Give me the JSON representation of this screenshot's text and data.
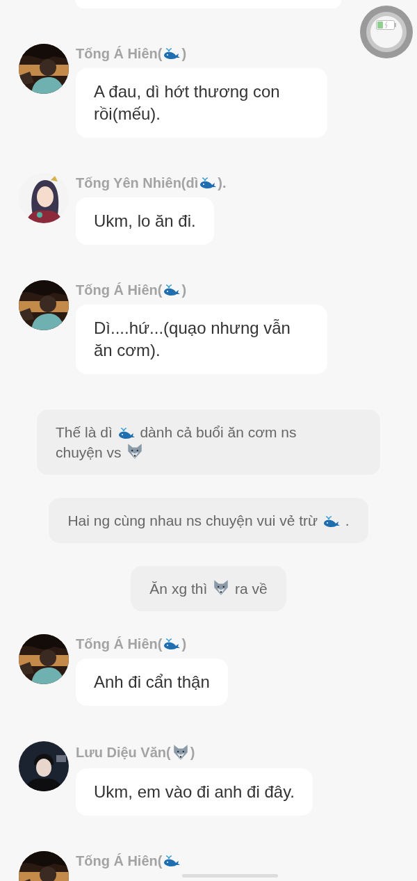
{
  "items": [
    {
      "kind": "cut_bubble"
    },
    {
      "kind": "message",
      "avatar": {
        "kind": "picture"
      },
      "name": [
        {
          "kind": "text",
          "text": "Tống Á Hiên("
        },
        {
          "kind": "whale"
        },
        {
          "kind": "text",
          "text": ")"
        }
      ],
      "text": [
        {
          "kind": "text",
          "text": "A đau, dì hớt thương con rồi(mếu)."
        }
      ]
    },
    {
      "kind": "message",
      "avatar": {
        "kind": "picture"
      },
      "name": [
        {
          "kind": "text",
          "text": "Tống Yên Nhiên(dì"
        },
        {
          "kind": "whale"
        },
        {
          "kind": "text",
          "text": ")."
        }
      ],
      "text": [
        {
          "kind": "text",
          "text": "Ukm, lo ăn đi."
        }
      ]
    },
    {
      "kind": "message",
      "avatar": {
        "kind": "picture"
      },
      "name": [
        {
          "kind": "text",
          "text": "Tống Á Hiên("
        },
        {
          "kind": "whale"
        },
        {
          "kind": "text",
          "text": ")"
        }
      ],
      "text": [
        {
          "kind": "text",
          "text": "Dì....hứ...(quạo nhưng vẫn ăn cơm)."
        }
      ]
    },
    {
      "kind": "narration",
      "text": [
        {
          "kind": "text",
          "text": "Thế là dì"
        },
        {
          "kind": "whale"
        },
        {
          "kind": "text",
          "text": "dành cả buổi ăn cơm ns"
        },
        {
          "kind": "text",
          "text": "chuyện vs"
        },
        {
          "kind": "wolf"
        }
      ]
    },
    {
      "kind": "narration",
      "text": [
        {
          "kind": "text",
          "text": "Hai ng cùng nhau ns chuyện vui vẻ trừ"
        },
        {
          "kind": "whale"
        },
        {
          "kind": "text",
          "text": "."
        }
      ]
    },
    {
      "kind": "narration",
      "text": [
        {
          "kind": "text",
          "text": "Ăn xg thì"
        },
        {
          "kind": "wolf"
        },
        {
          "kind": "text",
          "text": "ra về"
        }
      ]
    },
    {
      "kind": "message",
      "avatar": {
        "kind": "picture"
      },
      "name": [
        {
          "kind": "text",
          "text": "Tống Á Hiên("
        },
        {
          "kind": "whale"
        },
        {
          "kind": "text",
          "text": ")"
        }
      ],
      "text": [
        {
          "kind": "text",
          "text": "Anh đi cẩn thận"
        }
      ]
    },
    {
      "kind": "message",
      "avatar": {
        "kind": "picture"
      },
      "name": [
        {
          "kind": "text",
          "text": "Lưu Diệu Văn("
        },
        {
          "kind": "wolf"
        },
        {
          "kind": "text",
          "text": ")"
        }
      ],
      "text": [
        {
          "kind": "text",
          "text": "Ukm, em vào đi anh đi đây."
        }
      ]
    },
    {
      "kind": "message",
      "avatar": {
        "kind": "picture"
      },
      "name": [
        {
          "kind": "text",
          "text": "Tống Á Hiên("
        },
        {
          "kind": "whale"
        }
      ]
    }
  ]
}
